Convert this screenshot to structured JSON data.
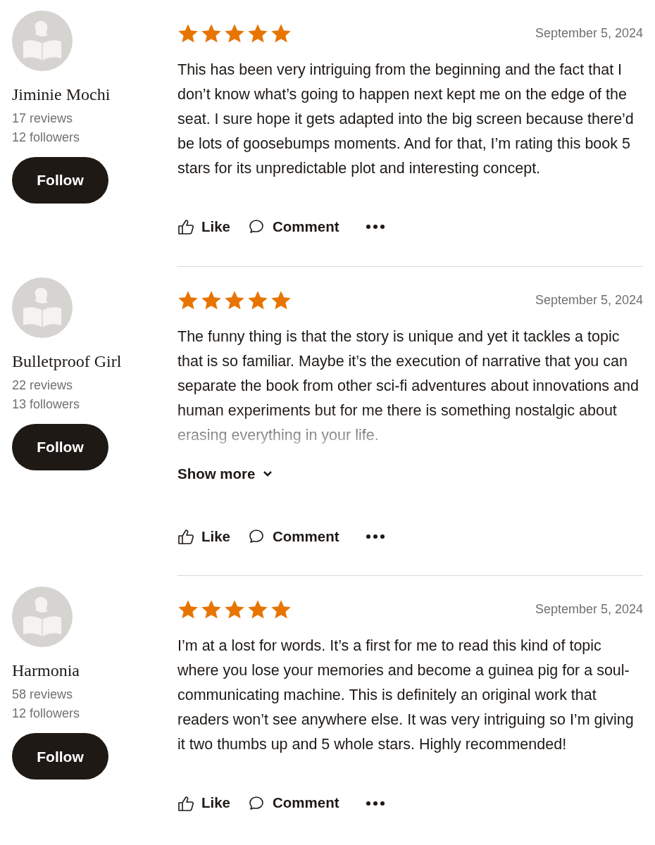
{
  "reviews": [
    {
      "name": "Jiminie Mochi",
      "reviews": "17 reviews",
      "followers": "12 followers",
      "follow": "Follow",
      "stars": 5,
      "date": "September 5, 2024",
      "body": "This has been very intriguing from the beginning and the fact that I don’t know what’s going to happen next kept me on the edge of the seat. I sure hope it gets adapted into the big screen because there’d be lots of goosebumps moments. And for that, I’m rating this book 5 stars for its unpredictable plot and interesting concept.",
      "truncated": false,
      "like": "Like",
      "comment": "Comment"
    },
    {
      "name": "Bulletproof Girl",
      "reviews": "22 reviews",
      "followers": "13 followers",
      "follow": "Follow",
      "stars": 5,
      "date": "September 5, 2024",
      "body": "The funny thing is that the story is unique and yet it tackles a topic that is so familiar. Maybe it’s the execution of narrative that you can separate the book from other sci-fi adventures about innovations and human experiments but for me there is something nostalgic about erasing everything in your life.",
      "truncated": true,
      "show_more": "Show more",
      "like": "Like",
      "comment": "Comment"
    },
    {
      "name": "Harmonia",
      "reviews": "58 reviews",
      "followers": "12 followers",
      "follow": "Follow",
      "stars": 5,
      "date": "September 5, 2024",
      "body": "I’m at a lost for words. It’s a first for me to read this kind of topic where you lose your memories and become a guinea pig for a soul-communicating machine. This is definitely an original work that readers won’t see anywhere else. It was very intriguing so I’m giving it two thumbs up and 5 whole stars. Highly recommended!",
      "truncated": false,
      "like": "Like",
      "comment": "Comment"
    }
  ]
}
